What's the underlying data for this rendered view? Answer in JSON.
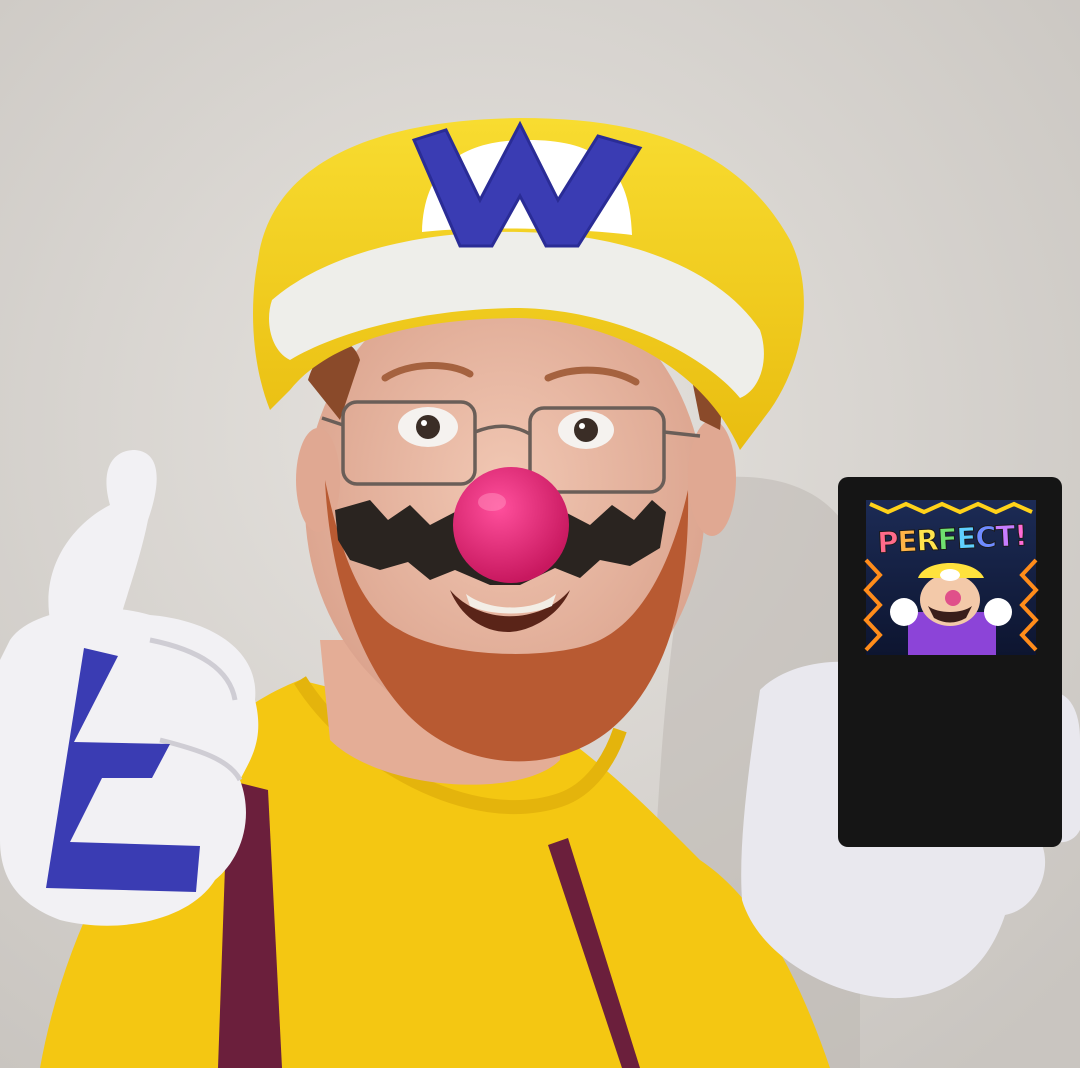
{
  "photo": {
    "subject": "person-in-wario-costume",
    "colors": {
      "wall": "#d9d6d2",
      "hat_yellow": "#f5d21a",
      "hat_brim": "#eeeeea",
      "emblem_blue": "#3a3cb3",
      "shirt_yellow": "#f4c712",
      "suspenders": "#6b1f3c",
      "nose_pink": "#e8297a",
      "mustache": "#2a2420",
      "beard": "#b85a32",
      "skin": "#eab9a4",
      "glove": "#f2f1f4",
      "console_body": "#151515",
      "screen_purple": "#8c44d8"
    }
  },
  "device_screen": {
    "text": "PERFECT!",
    "letter_colors": [
      "#ff6b8a",
      "#ffb347",
      "#ffe44d",
      "#6fe06f",
      "#5fd0ff",
      "#6f8bff",
      "#c77dff",
      "#ff6bd6"
    ]
  }
}
